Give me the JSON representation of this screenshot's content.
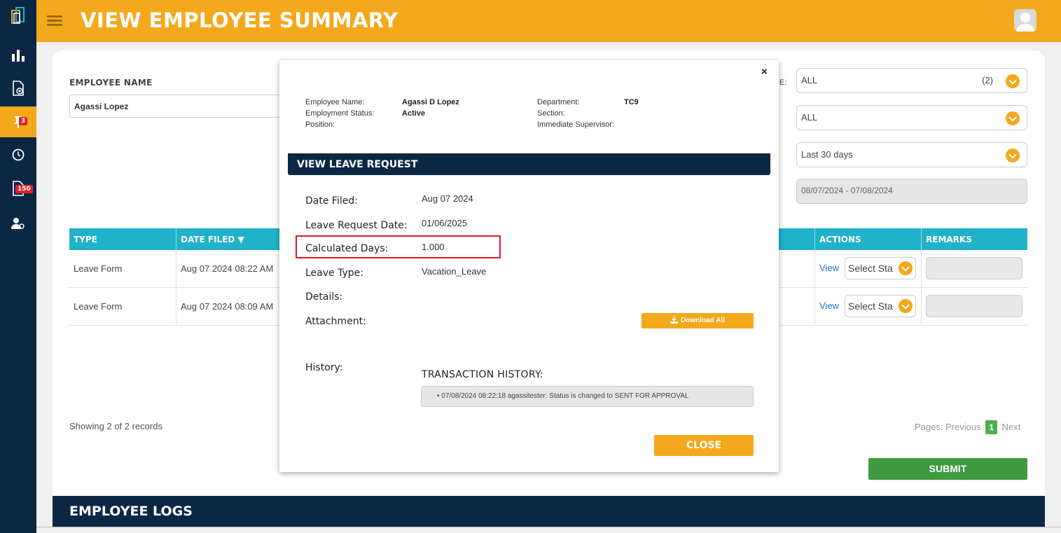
{
  "header": {
    "title": "VIEW EMPLOYEE SUMMARY",
    "accent_color": "#f4a81c",
    "nav_color": "#0b2744"
  },
  "sidebar": {
    "items": [
      {
        "icon": "building-logo-icon"
      },
      {
        "icon": "bar-chart-icon"
      },
      {
        "icon": "add-document-icon"
      },
      {
        "icon": "pin-icon",
        "badge": "3",
        "active": true
      },
      {
        "icon": "clock-icon"
      },
      {
        "icon": "document-icon",
        "badge": "150"
      },
      {
        "icon": "user-settings-icon"
      }
    ]
  },
  "filters": {
    "employee_name_label": "EMPLOYEE NAME",
    "employee_name_value": "Agassi Lopez",
    "partial_label": "E:",
    "status_select": {
      "value": "ALL",
      "count": "(2)"
    },
    "type_select": {
      "value": "ALL"
    },
    "period_select": {
      "value": "Last 30 days"
    },
    "date_range": "08/07/2024 - 07/08/2024"
  },
  "table": {
    "headers": {
      "type": "TYPE",
      "date_filed": "DATE FILED ▼",
      "actions": "ACTIONS",
      "remarks": "REMARKS"
    },
    "rows": [
      {
        "type": "Leave Form",
        "date_filed": "Aug 07 2024 08:22 AM",
        "view": "View",
        "select": "Select Sta"
      },
      {
        "type": "Leave Form",
        "date_filed": "Aug 07 2024 08:09 AM",
        "view": "View",
        "select": "Select Sta"
      }
    ],
    "showing": "Showing 2 of 2 records",
    "pager": {
      "label": "Pages:",
      "previous": "Previous",
      "current": "1",
      "next": "Next"
    },
    "submit_label": "SUBMIT"
  },
  "logs": {
    "title": "EMPLOYEE LOGS"
  },
  "modal": {
    "close_glyph": "×",
    "employee_info": {
      "name_label": "Employee Name:",
      "name_value": "Agassi D Lopez",
      "status_label": "Employment Status:",
      "status_value": "Active",
      "position_label": "Position:",
      "department_label": "Department:",
      "department_value": "TC9",
      "section_label": "Section:",
      "supervisor_label": "Immediate Supervisor:"
    },
    "section_title": "VIEW LEAVE REQUEST",
    "fields": {
      "date_filed_label": "Date Filed:",
      "date_filed_value": "Aug 07 2024",
      "request_date_label": "Leave Request Date:",
      "request_date_value": "01/06/2025",
      "calculated_days_label": "Calculated Days:",
      "calculated_days_value": "1.000",
      "leave_type_label": "Leave Type:",
      "leave_type_value": "Vacation_Leave",
      "details_label": "Details:",
      "attachment_label": "Attachment:",
      "download_all_label": "Download All",
      "history_label": "History:"
    },
    "transaction_history_title": "TRANSACTION HISTORY:",
    "history_entries": [
      "07/08/2024 08:22:18 agassitester: Status is changed to SENT FOR APPROVAL"
    ],
    "close_label": "CLOSE",
    "highlight_color": "#e01b24"
  }
}
